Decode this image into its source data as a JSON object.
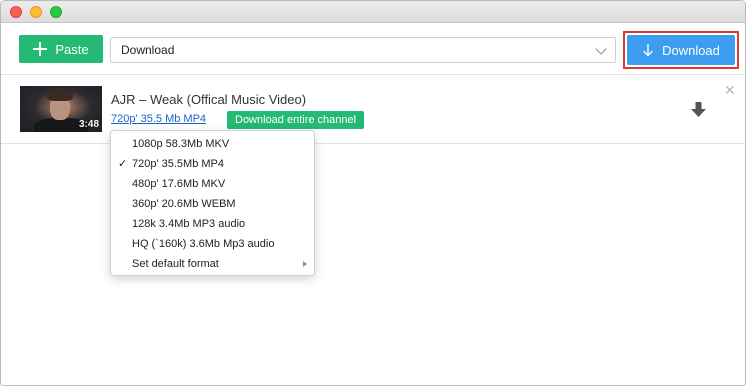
{
  "toolbar": {
    "paste_label": "Paste",
    "select_value": "Download",
    "download_label": "Download"
  },
  "colors": {
    "accent_green": "#24b974",
    "accent_blue": "#3c9cf0",
    "highlight_red": "#d93b33",
    "link_blue": "#1a64c8"
  },
  "item": {
    "title": "AJR – Weak (Offical Music Video)",
    "duration": "3:48",
    "selected_format": "720p' 35.5 Mb MP4",
    "channel_button": "Download entire channel",
    "close_glyph": "✕"
  },
  "menu": {
    "items": [
      {
        "label": "1080p 58.3Mb MKV",
        "checked": false
      },
      {
        "label": "720p' 35.5Mb MP4",
        "checked": true,
        "check_glyph": "✓"
      },
      {
        "label": "480p' 17.6Mb MKV",
        "checked": false
      },
      {
        "label": "360p' 20.6Mb WEBM",
        "checked": false
      },
      {
        "label": "128k 3.4Mb MP3 audio",
        "checked": false
      },
      {
        "label": "HQ (`160k) 3.6Mb Mp3 audio",
        "checked": false
      },
      {
        "label": "Set default format",
        "submenu": true
      }
    ]
  },
  "icons": [
    "plus-icon",
    "chevron-down-icon",
    "arrow-down-icon",
    "download-icon",
    "close-icon",
    "checkmark-icon",
    "submenu-arrow-icon"
  ]
}
